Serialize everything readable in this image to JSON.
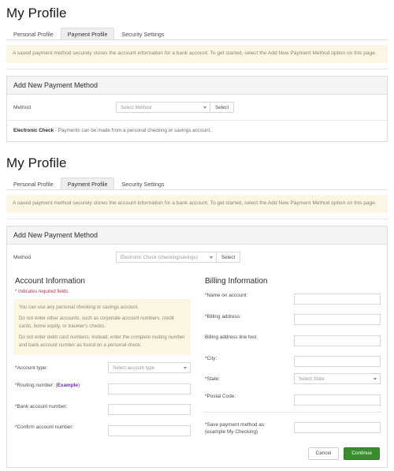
{
  "sections": [
    {
      "title": "My Profile",
      "tabs": [
        {
          "label": "Personal Profile",
          "active": false
        },
        {
          "label": "Payment Profile",
          "active": true
        },
        {
          "label": "Security Settings",
          "active": false
        }
      ],
      "banner": "A saved payment method securely stores the account information for a bank account. To get started, select the Add New Payment Method option on this page.",
      "panel_title": "Add New Payment Method",
      "method_label": "Method",
      "method_value": "Select Method",
      "select_button": "Select",
      "method_desc_bold": "Electronic Check",
      "method_desc_rest": " - Payments can be made from a personal checking or savings account."
    },
    {
      "title": "My Profile",
      "tabs": [
        {
          "label": "Personal Profile",
          "active": false
        },
        {
          "label": "Payment Profile",
          "active": true
        },
        {
          "label": "Security Settings",
          "active": false
        }
      ],
      "banner": "A saved payment method securely stores the account information for a bank account. To get started, select the Add New Payment Method option on this page.",
      "panel_title": "Add New Payment Method",
      "method_label": "Method",
      "method_value": "Electronic Check (checking/savings)",
      "select_button": "Select"
    }
  ],
  "account_information": {
    "heading": "Account Information",
    "required_note": "* Indicates required fields",
    "notes": [
      "You can use any personal checking or savings account.",
      "Do not enter other accounts, such as corporate account numbers, credit cards, home equity, or traveler's checks.",
      "Do not enter debit card numbers. Instead, enter the complete routing number and bank account number as found on a personal check."
    ],
    "fields": [
      {
        "label": "*Account type:",
        "type": "select",
        "value": "Select account type"
      },
      {
        "label": "*Routing number: (",
        "link": "Example",
        "label_after": ")",
        "type": "text",
        "value": ""
      },
      {
        "label": "*Bank account number:",
        "type": "text",
        "value": ""
      },
      {
        "label": "*Confirm account number:",
        "type": "text",
        "value": ""
      }
    ]
  },
  "billing_information": {
    "heading": "Billing Information",
    "fields": [
      {
        "label": "*Name on account:",
        "type": "text",
        "value": ""
      },
      {
        "label": "*Billing address:",
        "type": "text",
        "value": ""
      },
      {
        "label": "Billing address line two:",
        "type": "text",
        "value": ""
      },
      {
        "label": "*City:",
        "type": "text",
        "value": ""
      },
      {
        "label": "*State:",
        "type": "select",
        "value": "Select State"
      },
      {
        "label": "*Postal Code:",
        "type": "text",
        "value": ""
      }
    ],
    "save_as": {
      "label_line1": "*Save payment method as:",
      "label_line2": "(example My Checking)",
      "value": ""
    }
  },
  "footer": {
    "cancel_label": "Cancel",
    "continue_label": "Continue"
  },
  "colors": {
    "banner_bg": "#fbf6e3",
    "active_tab_bg": "#eeeeee",
    "panel_head_bg": "#f4f4f4",
    "continue_green": "#3b8b31",
    "required_red": "#b0384a",
    "link_purple": "#6a2fb5"
  }
}
